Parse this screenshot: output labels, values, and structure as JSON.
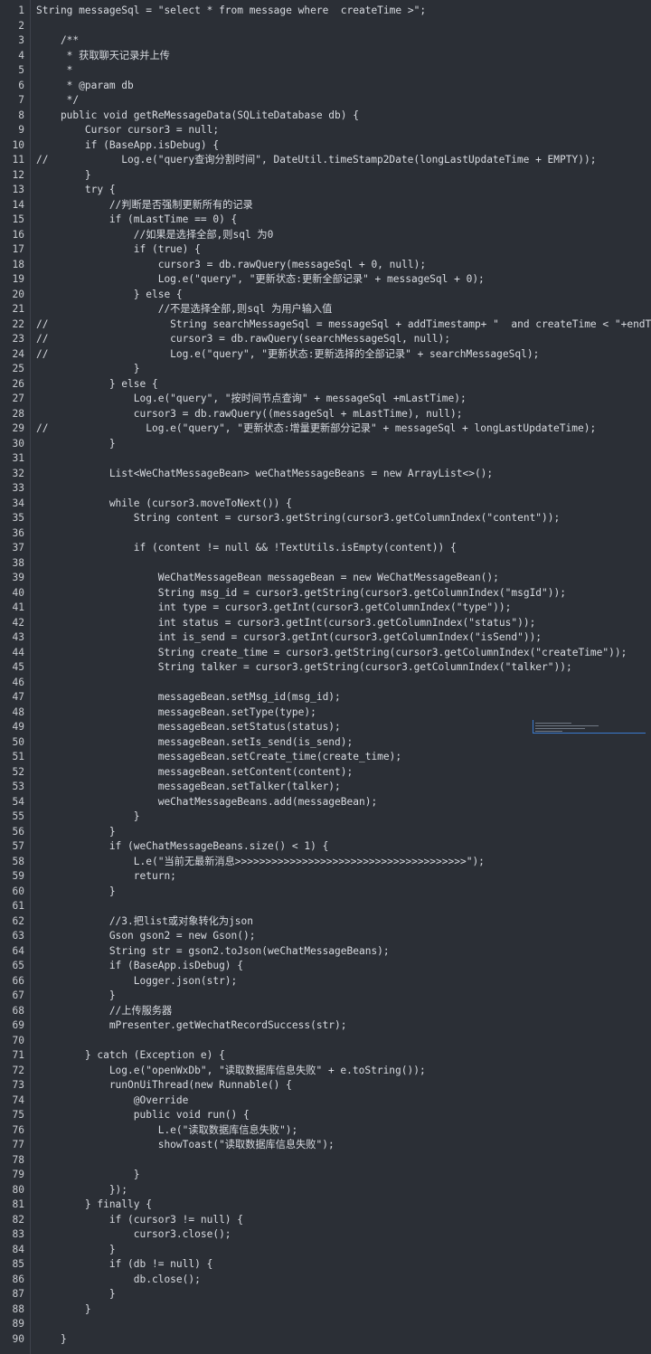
{
  "editor": {
    "lines": [
      {
        "n": "1",
        "text": "String messageSql = \"select * from message where  createTime >\";"
      },
      {
        "n": "2",
        "text": ""
      },
      {
        "n": "3",
        "text": "    /**"
      },
      {
        "n": "4",
        "text": "     * 获取聊天记录并上传"
      },
      {
        "n": "5",
        "text": "     *"
      },
      {
        "n": "6",
        "text": "     * @param db"
      },
      {
        "n": "7",
        "text": "     */"
      },
      {
        "n": "8",
        "text": "    public void getReMessageData(SQLiteDatabase db) {"
      },
      {
        "n": "9",
        "text": "        Cursor cursor3 = null;"
      },
      {
        "n": "10",
        "text": "        if (BaseApp.isDebug) {"
      },
      {
        "n": "11",
        "text": "//            Log.e(\"query查询分割时间\", DateUtil.timeStamp2Date(longLastUpdateTime + EMPTY));"
      },
      {
        "n": "12",
        "text": "        }"
      },
      {
        "n": "13",
        "text": "        try {"
      },
      {
        "n": "14",
        "text": "            //判断是否强制更新所有的记录"
      },
      {
        "n": "15",
        "text": "            if (mLastTime == 0) {"
      },
      {
        "n": "16",
        "text": "                //如果是选择全部,则sql 为0"
      },
      {
        "n": "17",
        "text": "                if (true) {"
      },
      {
        "n": "18",
        "text": "                    cursor3 = db.rawQuery(messageSql + 0, null);"
      },
      {
        "n": "19",
        "text": "                    Log.e(\"query\", \"更新状态:更新全部记录\" + messageSql + 0);"
      },
      {
        "n": "20",
        "text": "                } else {"
      },
      {
        "n": "21",
        "text": "                    //不是选择全部,则sql 为用户输入值"
      },
      {
        "n": "22",
        "text": "//                    String searchMessageSql = messageSql + addTimestamp+ \"  and createTime < \"+endTimest"
      },
      {
        "n": "23",
        "text": "//                    cursor3 = db.rawQuery(searchMessageSql, null);"
      },
      {
        "n": "24",
        "text": "//                    Log.e(\"query\", \"更新状态:更新选择的全部记录\" + searchMessageSql);"
      },
      {
        "n": "25",
        "text": "                }"
      },
      {
        "n": "26",
        "text": "            } else {"
      },
      {
        "n": "27",
        "text": "                Log.e(\"query\", \"按时间节点查询\" + messageSql +mLastTime);"
      },
      {
        "n": "28",
        "text": "                cursor3 = db.rawQuery((messageSql + mLastTime), null);"
      },
      {
        "n": "29",
        "text": "//                Log.e(\"query\", \"更新状态:增量更新部分记录\" + messageSql + longLastUpdateTime);"
      },
      {
        "n": "30",
        "text": "            }"
      },
      {
        "n": "31",
        "text": ""
      },
      {
        "n": "32",
        "text": "            List<WeChatMessageBean> weChatMessageBeans = new ArrayList<>();"
      },
      {
        "n": "33",
        "text": ""
      },
      {
        "n": "34",
        "text": "            while (cursor3.moveToNext()) {"
      },
      {
        "n": "35",
        "text": "                String content = cursor3.getString(cursor3.getColumnIndex(\"content\"));"
      },
      {
        "n": "36",
        "text": ""
      },
      {
        "n": "37",
        "text": "                if (content != null && !TextUtils.isEmpty(content)) {"
      },
      {
        "n": "38",
        "text": ""
      },
      {
        "n": "39",
        "text": "                    WeChatMessageBean messageBean = new WeChatMessageBean();"
      },
      {
        "n": "40",
        "text": "                    String msg_id = cursor3.getString(cursor3.getColumnIndex(\"msgId\"));"
      },
      {
        "n": "41",
        "text": "                    int type = cursor3.getInt(cursor3.getColumnIndex(\"type\"));"
      },
      {
        "n": "42",
        "text": "                    int status = cursor3.getInt(cursor3.getColumnIndex(\"status\"));"
      },
      {
        "n": "43",
        "text": "                    int is_send = cursor3.getInt(cursor3.getColumnIndex(\"isSend\"));"
      },
      {
        "n": "44",
        "text": "                    String create_time = cursor3.getString(cursor3.getColumnIndex(\"createTime\"));"
      },
      {
        "n": "45",
        "text": "                    String talker = cursor3.getString(cursor3.getColumnIndex(\"talker\"));"
      },
      {
        "n": "46",
        "text": ""
      },
      {
        "n": "47",
        "text": "                    messageBean.setMsg_id(msg_id);"
      },
      {
        "n": "48",
        "text": "                    messageBean.setType(type);"
      },
      {
        "n": "49",
        "text": "                    messageBean.setStatus(status);"
      },
      {
        "n": "50",
        "text": "                    messageBean.setIs_send(is_send);"
      },
      {
        "n": "51",
        "text": "                    messageBean.setCreate_time(create_time);"
      },
      {
        "n": "52",
        "text": "                    messageBean.setContent(content);"
      },
      {
        "n": "53",
        "text": "                    messageBean.setTalker(talker);"
      },
      {
        "n": "54",
        "text": "                    weChatMessageBeans.add(messageBean);"
      },
      {
        "n": "55",
        "text": "                }"
      },
      {
        "n": "56",
        "text": "            }"
      },
      {
        "n": "57",
        "text": "            if (weChatMessageBeans.size() < 1) {"
      },
      {
        "n": "58",
        "text": "                L.e(\"当前无最新消息>>>>>>>>>>>>>>>>>>>>>>>>>>>>>>>>>>>>>>\");"
      },
      {
        "n": "59",
        "text": "                return;"
      },
      {
        "n": "60",
        "text": "            }"
      },
      {
        "n": "61",
        "text": ""
      },
      {
        "n": "62",
        "text": "            //3.把list或对象转化为json"
      },
      {
        "n": "63",
        "text": "            Gson gson2 = new Gson();"
      },
      {
        "n": "64",
        "text": "            String str = gson2.toJson(weChatMessageBeans);"
      },
      {
        "n": "65",
        "text": "            if (BaseApp.isDebug) {"
      },
      {
        "n": "66",
        "text": "                Logger.json(str);"
      },
      {
        "n": "67",
        "text": "            }"
      },
      {
        "n": "68",
        "text": "            //上传服务器"
      },
      {
        "n": "69",
        "text": "            mPresenter.getWechatRecordSuccess(str);"
      },
      {
        "n": "70",
        "text": ""
      },
      {
        "n": "71",
        "text": "        } catch (Exception e) {"
      },
      {
        "n": "72",
        "text": "            Log.e(\"openWxDb\", \"读取数据库信息失败\" + e.toString());"
      },
      {
        "n": "73",
        "text": "            runOnUiThread(new Runnable() {"
      },
      {
        "n": "74",
        "text": "                @Override"
      },
      {
        "n": "75",
        "text": "                public void run() {"
      },
      {
        "n": "76",
        "text": "                    L.e(\"读取数据库信息失败\");"
      },
      {
        "n": "77",
        "text": "                    showToast(\"读取数据库信息失败\");"
      },
      {
        "n": "78",
        "text": ""
      },
      {
        "n": "79",
        "text": "                }"
      },
      {
        "n": "80",
        "text": "            });"
      },
      {
        "n": "81",
        "text": "        } finally {"
      },
      {
        "n": "82",
        "text": "            if (cursor3 != null) {"
      },
      {
        "n": "83",
        "text": "                cursor3.close();"
      },
      {
        "n": "84",
        "text": "            }"
      },
      {
        "n": "85",
        "text": "            if (db != null) {"
      },
      {
        "n": "86",
        "text": "                db.close();"
      },
      {
        "n": "87",
        "text": "            }"
      },
      {
        "n": "88",
        "text": "        }"
      },
      {
        "n": "89",
        "text": ""
      },
      {
        "n": "90",
        "text": "    }"
      }
    ]
  }
}
